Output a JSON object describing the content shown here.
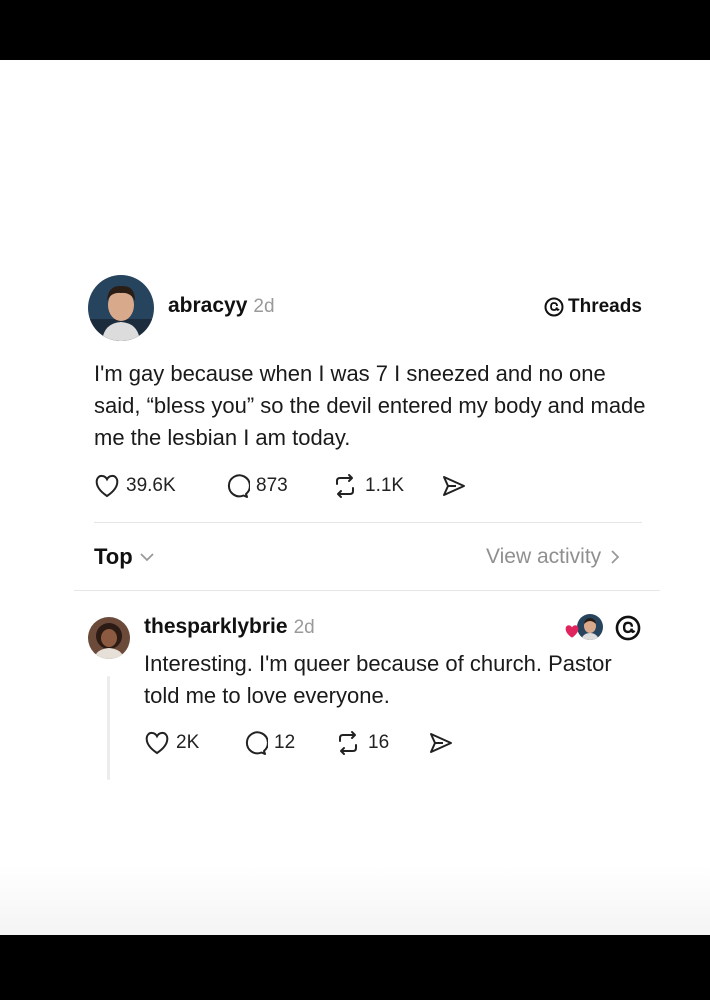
{
  "post": {
    "username": "abracyy",
    "time": "2d",
    "brand": "Threads",
    "text": "I'm gay because when I was 7 I sneezed and no one said, “bless you” so the devil entered my body and made me the lesbian I am today.",
    "likes": "39.6K",
    "replies": "873",
    "reposts": "1.1K"
  },
  "sort": {
    "label": "Top",
    "view_activity": "View activity"
  },
  "reply": {
    "username": "thesparklybrie",
    "time": "2d",
    "text": "Interesting. I'm queer because of church. Pastor told me to love everyone.",
    "likes": "2K",
    "replies": "12",
    "reposts": "16"
  },
  "colors": {
    "heart_badge": "#e0245e",
    "muted": "#9a9a9a",
    "text": "#111111"
  }
}
